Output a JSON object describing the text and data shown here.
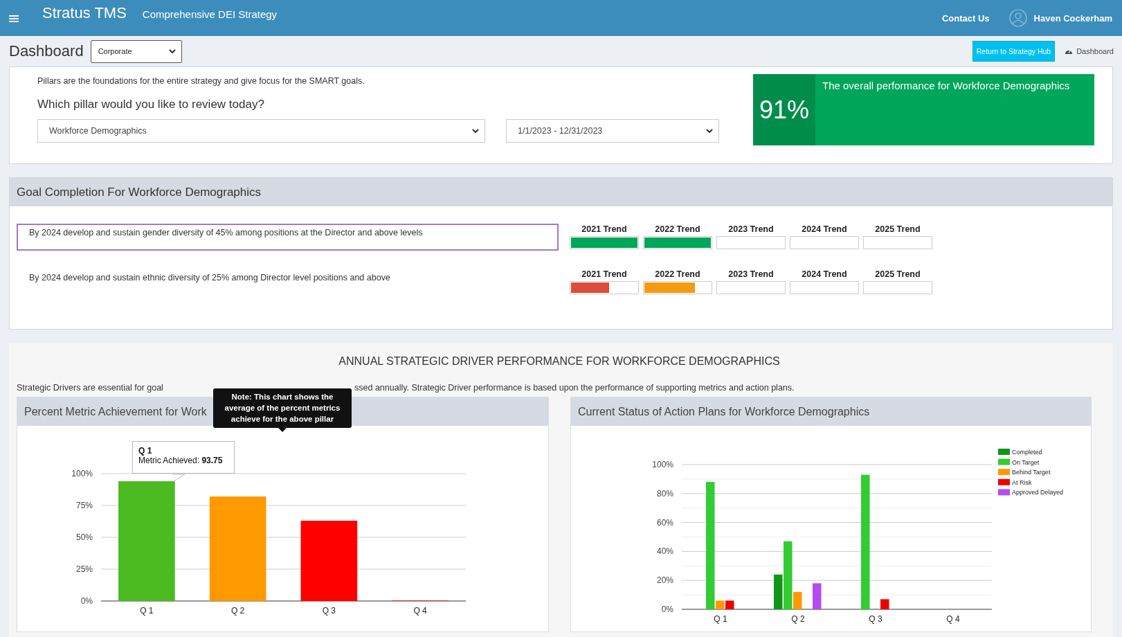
{
  "header": {
    "brand": "Stratus TMS",
    "subtitle": "Comprehensive DEI Strategy",
    "link": "Contact Us",
    "user": "Haven Cockerham"
  },
  "toolbar": {
    "title": "Dashboard",
    "scope_select": "Corporate",
    "button": "Return to Strategy Hub",
    "breadcrumb": "Dashboard"
  },
  "pillar_card": {
    "intro": "Pillars are the foundations for the entire strategy and give focus for the SMART goals.",
    "question": "Which pillar would you like to review today?",
    "pillar_select": "Workforce Demographics",
    "date_select": "1/1/2023 - 12/31/2023",
    "score": "91%",
    "score_caption": "The overall performance for Workforce Demographics"
  },
  "goals": {
    "title": "Goal Completion For Workforce Demographics",
    "items": [
      {
        "text": "By 2024 develop and sustain gender diversity of 45% among positions at the Director and above levels",
        "selected": true,
        "trends": [
          {
            "label": "2021 Trend",
            "level": 1,
            "color": "#00a65a"
          },
          {
            "label": "2022 Trend",
            "level": 1,
            "color": "#00a65a"
          },
          {
            "label": "2023 Trend"
          },
          {
            "label": "2024 Trend"
          },
          {
            "label": "2025 Trend"
          }
        ]
      },
      {
        "text": "By 2024 develop and sustain ethnic diversity of 25% among Director level positions and above",
        "selected": false,
        "trends": [
          {
            "label": "2021 Trend",
            "level": 0.57,
            "color": "#dd4b39"
          },
          {
            "label": "2022 Trend",
            "level": 0.76,
            "color": "#f39c12"
          },
          {
            "label": "2023 Trend"
          },
          {
            "label": "2024 Trend"
          },
          {
            "label": "2025 Trend"
          }
        ]
      }
    ]
  },
  "drivers": {
    "title": "ANNUAL STRATEGIC DRIVER PERFORMANCE FOR WORKFORCE DEMOGRAPHICS",
    "intro_start": "Strategic Drivers are essential for goal",
    "intro_end": "ssed annually. Strategic Driver performance is based upon the performance of supporting metrics and action plans.",
    "note_tooltip": "Note: This chart shows the average of the percent metrics achieve for the above pillar",
    "left_panel": {
      "title": "Percent Metric Achievement for Work",
      "chart_tooltip": {
        "title": "Q 1",
        "text": "Metric Achieved: **93.75**"
      },
      "chart_data": {
        "type": "bar",
        "categories": [
          "Q 1",
          "Q 2",
          "Q 3",
          "Q 4"
        ],
        "values": [
          94,
          82,
          63,
          0.5
        ],
        "colors": [
          "#4cbb22",
          "#ff9900",
          "#ff0000",
          "#dc3912"
        ],
        "grid": true,
        "ylim": [
          0,
          100
        ],
        "yticks": [
          {
            "value": 0,
            "label": "0%"
          },
          {
            "value": 25,
            "label": "25%"
          },
          {
            "value": 50,
            "label": "50%"
          },
          {
            "value": 75,
            "label": "75%"
          },
          {
            "value": 100,
            "label": "100%"
          }
        ]
      }
    },
    "right_panel": {
      "title": "Current Status of Action Plans for Workforce Demographics",
      "chart_data": {
        "type": "bar",
        "categories": [
          "Q 1",
          "Q 2",
          "Q 3",
          "Q 4"
        ],
        "series": [
          {
            "name": "Completed",
            "color": "#109618",
            "values": [
              0,
              24,
              0,
              0
            ]
          },
          {
            "name": "On Target",
            "color": "#33cc33",
            "values": [
              88,
              47,
              93,
              0
            ]
          },
          {
            "name": "Behind Target",
            "color": "#ff9900",
            "values": [
              6,
              12,
              0,
              0
            ]
          },
          {
            "name": "At Risk",
            "color": "#ee0000",
            "values": [
              6,
              0,
              7,
              0
            ]
          },
          {
            "name": "Approved Delayed",
            "color": "#b44cf0",
            "values": [
              0,
              18,
              0,
              0
            ]
          }
        ],
        "grid": true,
        "legend": "right",
        "ylim": [
          0,
          100
        ],
        "yticks": [
          {
            "value": 0,
            "label": "0%"
          },
          {
            "value": 20,
            "label": "20%"
          },
          {
            "value": 40,
            "label": "40%"
          },
          {
            "value": 60,
            "label": "60%"
          },
          {
            "value": 80,
            "label": "80%"
          },
          {
            "value": 100,
            "label": "100%"
          }
        ]
      }
    }
  }
}
